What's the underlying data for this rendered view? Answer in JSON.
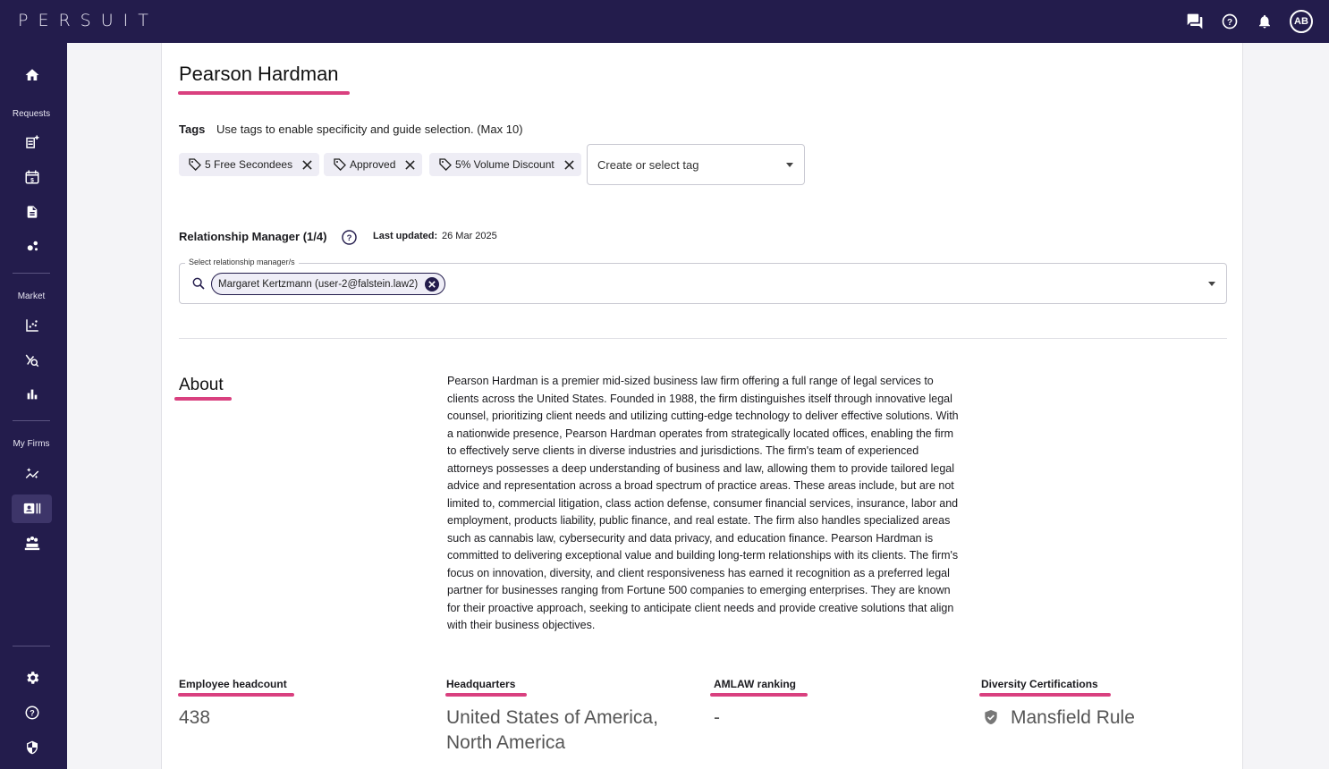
{
  "app": {
    "logo": "PERSUIT",
    "user_initials": "AB"
  },
  "topbar": {
    "icons": [
      "chat-icon",
      "help-icon",
      "bell-icon"
    ]
  },
  "sidebar": {
    "sections": [
      "Requests",
      "Market",
      "My Firms"
    ],
    "items": [
      "home-icon",
      "new-request-icon",
      "calendar-billing-icon",
      "document-icon",
      "network-icon",
      "market-chart-icon",
      "market-search-icon",
      "bar-chart-icon",
      "sparkle-chart-icon",
      "firm-card-icon",
      "firms-group-icon",
      "settings-icon",
      "help-icon",
      "shield-icon"
    ],
    "accent": "#231c4c"
  },
  "firm": {
    "name": "Pearson Hardman",
    "tags_label": "Tags",
    "tags_help": "Use tags to enable specificity and guide selection. (Max 10)",
    "tags": [
      "5 Free Secondees",
      "Approved",
      "5% Volume Discount"
    ],
    "tag_select_placeholder": "Create or select tag",
    "rm_label": "Relationship Manager (1/4)",
    "last_updated_label": "Last updated:",
    "last_updated_value": "26 Mar 2025",
    "rm_field_label": "Select relationship manager/s",
    "rm_selected": "Margaret Kertzmann (user-2@falstein.law2)",
    "about_title": "About",
    "about_text": "Pearson Hardman is a premier mid-sized business law firm offering a full range of legal services to clients across the United States. Founded in 1988, the firm distinguishes itself through innovative legal counsel, prioritizing client needs and utilizing cutting-edge technology to deliver effective solutions. With a nationwide presence, Pearson Hardman operates from strategically located offices, enabling the firm to effectively serve clients in diverse industries and jurisdictions. The firm's team of experienced attorneys possesses a deep understanding of business and law, allowing them to provide tailored legal advice and representation across a broad spectrum of practice areas. These areas include, but are not limited to, commercial litigation, class action defense, consumer financial services, insurance, labor and employment, products liability, public finance, and real estate. The firm also handles specialized areas such as cannabis law, cybersecurity and data privacy, and education finance. Pearson Hardman is committed to delivering exceptional value and building long-term relationships with its clients. The firm's focus on innovation, diversity, and client responsiveness has earned it recognition as a preferred legal partner for businesses ranging from Fortune 500 companies to emerging enterprises. They are known for their proactive approach, seeking to anticipate client needs and provide creative solutions that align with their business objectives.",
    "stats": {
      "headcount_label": "Employee headcount",
      "headcount_value": "438",
      "hq_label": "Headquarters",
      "hq_value_line1": "United States of America,",
      "hq_value_line2": "North America",
      "amlaw_label": "AMLAW ranking",
      "amlaw_value": "-",
      "diversity_label": "Diversity Certifications",
      "diversity_value": "Mansfield Rule"
    },
    "highlight_color": "#d9407f"
  }
}
